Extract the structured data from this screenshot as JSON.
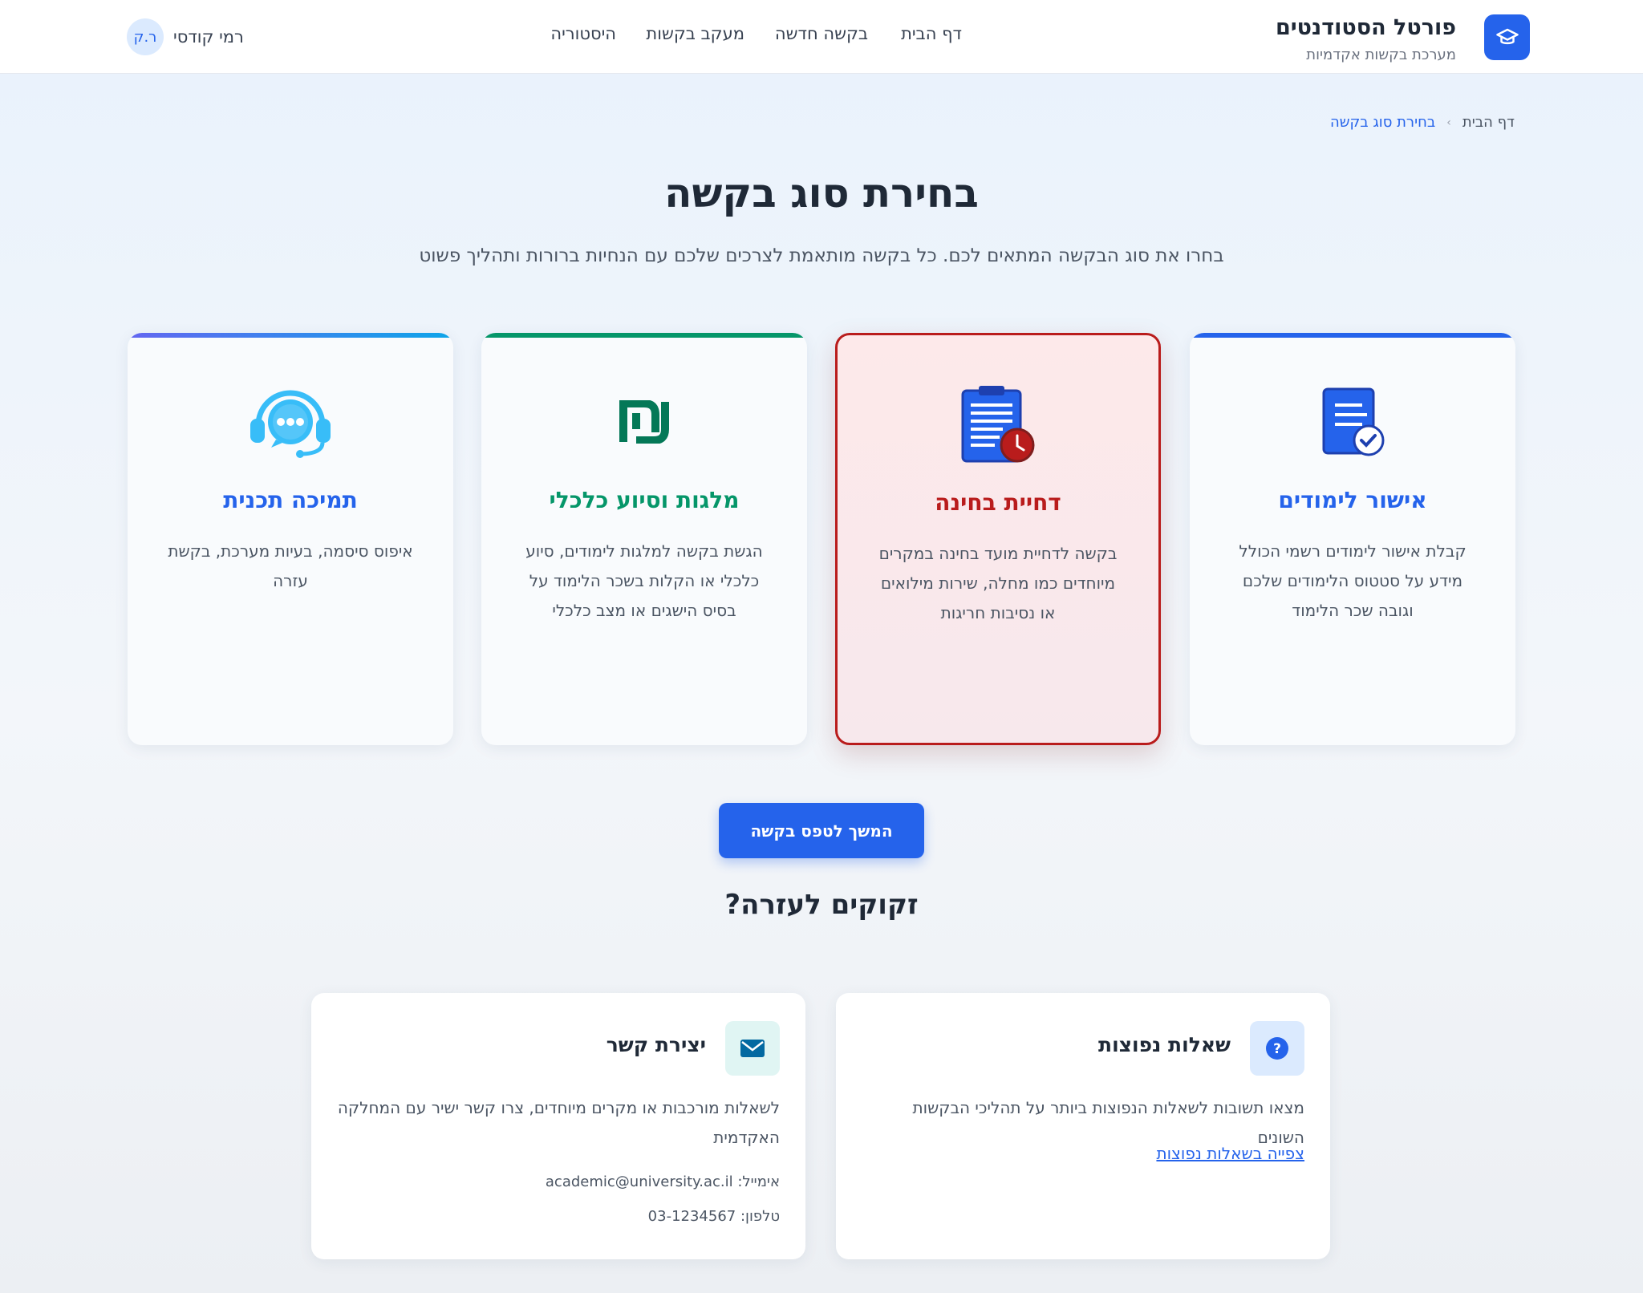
{
  "header": {
    "brand_title": "פורטל הסטודנטים",
    "brand_subtitle": "מערכת בקשות אקדמיות",
    "nav": [
      "דף הבית",
      "בקשה חדשה",
      "מעקב בקשות",
      "היסטוריה"
    ],
    "user": {
      "initials": "ר.ק",
      "name": "רמי קודסי"
    }
  },
  "breadcrumb": {
    "home": "דף הבית",
    "separator": "›",
    "current": "בחירת סוג בקשה"
  },
  "page": {
    "title": "בחירת סוג בקשה",
    "subtitle": "בחרו את סוג הבקשה המתאים לכם. כל בקשה מותאמת לצרכים שלכם עם הנחיות ברורות ותהליך פשוט"
  },
  "cards": [
    {
      "title": "אישור לימודים",
      "desc": "קבלת אישור לימודים רשמי הכולל מידע על סטטוס הלימודים שלכם וגובה שכר הלימוד",
      "icon": "document-check-icon",
      "color": "#2563eb",
      "selected": false
    },
    {
      "title": "דחיית בחינה",
      "desc": "בקשה לדחיית מועד בחינה במקרים מיוחדים כמו מחלה, שירות מילואים או נסיבות חריגות",
      "icon": "clipboard-clock-icon",
      "color": "#b91c1c",
      "selected": true
    },
    {
      "title": "מלגות וסיוע כלכלי",
      "desc": "הגשת בקשה למלגות לימודים, סיוע כלכלי או הקלות בשכר הלימוד על בסיס הישגים או מצב כלכלי",
      "icon": "shekel-icon",
      "color": "#059669",
      "selected": false
    },
    {
      "title": "תמיכה תכנית",
      "desc": "איפוס סיסמה, בעיות מערכת, בקשת עזרה",
      "icon": "headset-chat-icon",
      "color": "#2563eb",
      "selected": false
    }
  ],
  "continue_button": "המשך לטפס בקשה",
  "help": {
    "title": "זקוקים לעזרה?",
    "faq": {
      "title": "שאלות נפוצות",
      "desc": "מצאו תשובות לשאלות הנפוצות ביותר על תהליכי הבקשות השונים",
      "link": "צפייה בשאלות נפוצות",
      "icon": "question-icon"
    },
    "contact": {
      "title": "יצירת קשר",
      "desc": "לשאלות מורכבות או מקרים מיוחדים, צרו קשר ישיר עם המחלקה האקדמית",
      "email": "אימייל: academic@university.ac.il",
      "phone": "טלפון: 03-1234567",
      "icon": "mail-icon"
    }
  }
}
